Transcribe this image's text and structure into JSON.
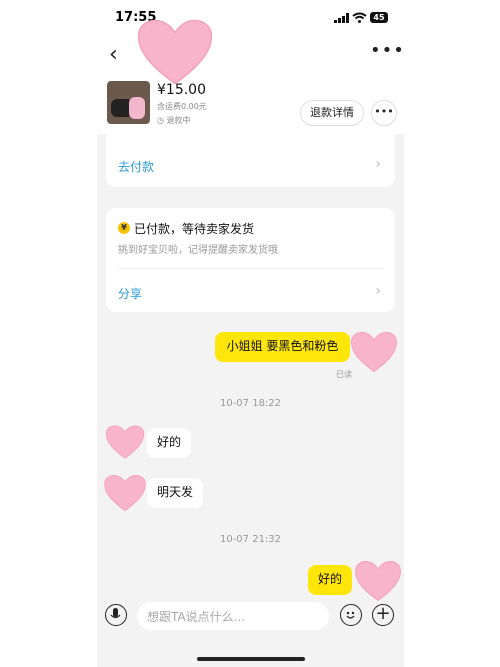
{
  "status_bar": {
    "time": "17:55",
    "battery": "45"
  },
  "product": {
    "price": "¥15.00",
    "shipping": "含运费0.00元",
    "state": "退款中",
    "refund_button": "退款详情",
    "more_button": "•••"
  },
  "card1": {
    "action": "去付款"
  },
  "card2": {
    "title": "已付款，等待卖家发货",
    "subtitle": "挑到好宝贝啦，记得提醒卖家发货哦",
    "action": "分享"
  },
  "messages": [
    {
      "side": "right",
      "text": "小姐姐 要黑色和粉色"
    },
    {
      "side": "left",
      "text": "好的"
    },
    {
      "side": "left",
      "text": "明天发"
    },
    {
      "side": "right",
      "text": "好的"
    }
  ],
  "read_receipt": "已读",
  "timestamps": [
    "10-07 18:22",
    "10-07 21:32"
  ],
  "input": {
    "placeholder": "想跟TA说点什么..."
  },
  "colors": {
    "accent_yellow": "#ffe60a",
    "link_blue": "#2a9bd8",
    "sticker_pink": "#f7b4cb"
  },
  "icons": [
    "back-arrow-icon",
    "more-dots-icon",
    "clock-icon",
    "chevron-right-icon",
    "coin-icon",
    "microphone-icon",
    "emoji-icon",
    "plus-icon"
  ]
}
